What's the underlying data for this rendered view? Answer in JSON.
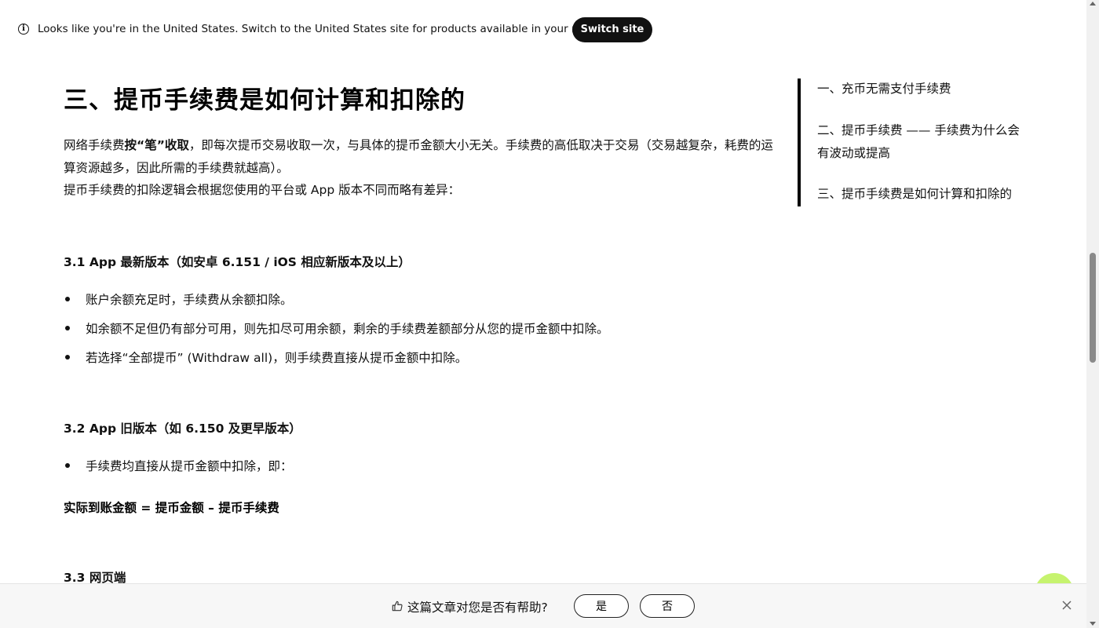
{
  "banner": {
    "message": "Looks like you're in the United States. Switch to the United States site for products available in your region.",
    "button_label": "Switch site"
  },
  "article": {
    "title": "三、提币手续费是如何计算和扣除的",
    "intro_pre": "网络手续费",
    "intro_bold": "按“笔”收取",
    "intro_post": "，即每次提币交易收取一次，与具体的提币金额大小无关。手续费的高低取决于交易（交易越复杂，耗费的运算资源越多，因此所需的手续费就越高）。",
    "intro_2": "提币手续费的扣除逻辑会根据您使用的平台或 App 版本不同而略有差异：",
    "section_1": {
      "heading": "3.1 App 最新版本（如安卓 6.151 / iOS 相应新版本及以上）",
      "bullets": [
        "账户余额充足时，手续费从余额扣除。",
        "如余额不足但仍有部分可用，则先扣尽可用余额，剩余的手续费差额部分从您的提币金额中扣除。",
        "若选择“全部提币” (Withdraw all)，则手续费直接从提币金额中扣除。"
      ]
    },
    "section_2": {
      "heading": "3.2 App 旧版本（如 6.150 及更早版本）",
      "bullets": [
        "手续费均直接从提币金额中扣除，即："
      ],
      "formula": "实际到账金额 = 提币金额 – 提币手续费"
    },
    "section_3": {
      "heading": "3.3 网页端"
    }
  },
  "toc": {
    "items": [
      "一、充币无需支付手续费",
      "二、提币手续费 —— 手续费为什么会有波动或提高",
      "三、提币手续费是如何计算和扣除的"
    ]
  },
  "feedback": {
    "question": "这篇文章对您是否有帮助?",
    "yes_label": "是",
    "no_label": "否"
  },
  "icons": {
    "info": "info-icon",
    "thumbs_up": "thumbs-up-icon",
    "close": "close-icon"
  }
}
